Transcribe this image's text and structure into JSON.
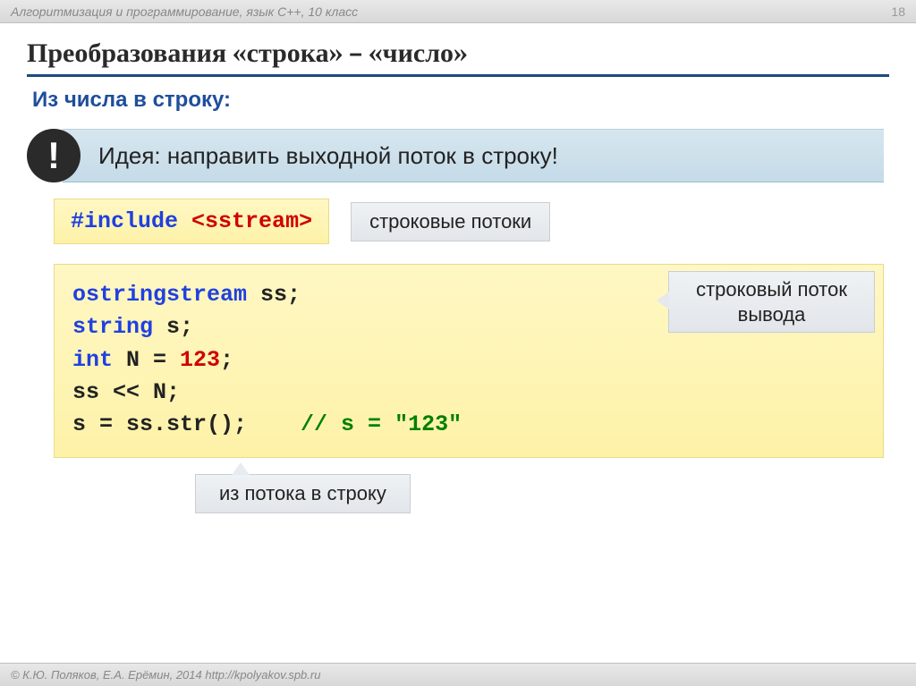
{
  "header": {
    "course": "Алгоритмизация и программирование, язык C++, 10 класс",
    "page": "18"
  },
  "title": "Преобразования «строка» – «число»",
  "subtitle": "Из числа в строку:",
  "idea": {
    "mark": "!",
    "text": "Идея: направить выходной поток в строку!"
  },
  "include": {
    "directive": "#include",
    "header": "<sstream>"
  },
  "callouts": {
    "streams": "строковые потоки",
    "ostream_line1": "строковый поток",
    "ostream_line2": "вывода",
    "tostr": "из потока в строку"
  },
  "code": {
    "l1_type": "ostringstream",
    "l1_rest": " ss;",
    "l2_type": "string",
    "l2_rest": " s;",
    "l3_type": "int",
    "l3_mid": " N = ",
    "l3_val": "123",
    "l3_end": ";",
    "l4": "ss << N;",
    "l5_left": "s = ss.str();    ",
    "l5_comment": "// s = \"123\""
  },
  "footer": "© К.Ю. Поляков, Е.А. Ерёмин, 2014   http://kpolyakov.spb.ru"
}
